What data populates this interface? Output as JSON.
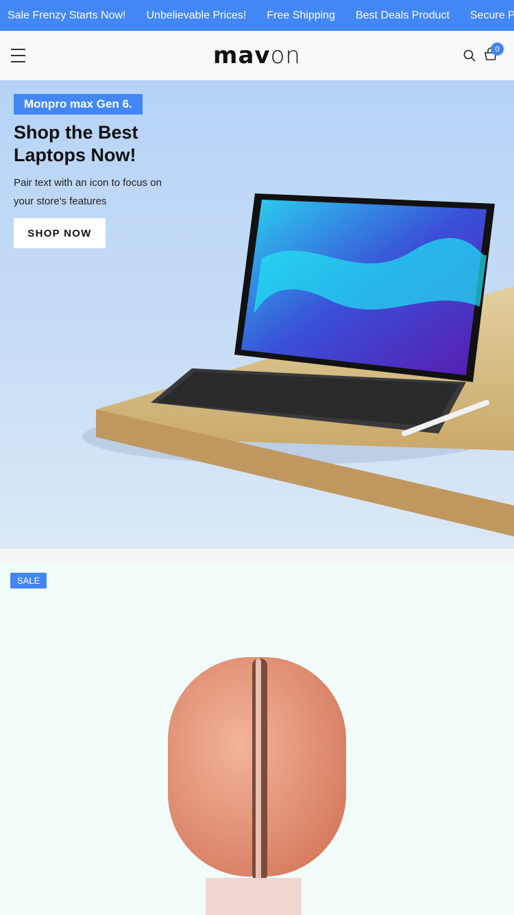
{
  "announcement": [
    "Sale Frenzy Starts Now!",
    "Unbelievable Prices!",
    "Free Shipping",
    "Best Deals Product",
    "Secure Payment"
  ],
  "header": {
    "logo_bold": "mav",
    "logo_light": "on",
    "cart_count": "0"
  },
  "hero": {
    "tag": "Monpro max Gen 6.",
    "title": "Shop the Best Laptops Now!",
    "subtitle": "Pair text with an icon to focus on your store's features",
    "button": "SHOP NOW"
  },
  "product": {
    "badge": "SALE"
  },
  "colors": {
    "accent": "#4287f5"
  }
}
